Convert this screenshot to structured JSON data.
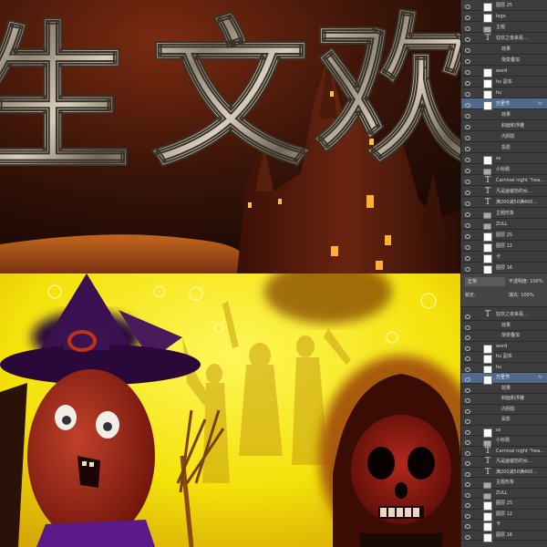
{
  "canvas_title_chars": [
    "生",
    "文",
    "欢"
  ],
  "top_layers": [
    {
      "name": "图层 25",
      "type": "image",
      "fx": ""
    },
    {
      "name": "logo",
      "type": "image",
      "fx": ""
    },
    {
      "name": "主题",
      "type": "folder",
      "fx": ""
    },
    {
      "name": "狂欢之夜来看…",
      "type": "text",
      "fx": ""
    },
    {
      "name": "效果",
      "type": "sub",
      "fx": ""
    },
    {
      "name": "渐变叠加",
      "type": "sub",
      "fx": ""
    },
    {
      "name": "word",
      "type": "image",
      "fx": ""
    },
    {
      "name": "hu 副本",
      "type": "image",
      "fx": ""
    },
    {
      "name": "hu",
      "type": "image",
      "fx": ""
    },
    {
      "name": "万圣节",
      "type": "image",
      "fx": "fx",
      "selected": true
    },
    {
      "name": "效果",
      "type": "sub",
      "fx": ""
    },
    {
      "name": "斜面和浮雕",
      "type": "sub",
      "fx": ""
    },
    {
      "name": "内阴影",
      "type": "sub",
      "fx": ""
    },
    {
      "name": "投影",
      "type": "sub",
      "fx": ""
    },
    {
      "name": "ss",
      "type": "image",
      "fx": ""
    },
    {
      "name": "小标题",
      "type": "folder",
      "fx": ""
    },
    {
      "name": "Carnival night \"hea…",
      "type": "text",
      "fx": ""
    },
    {
      "name": "凡是画装扮的女…",
      "type": "text",
      "fx": ""
    },
    {
      "name": "满200减50满400…",
      "type": "text",
      "fx": ""
    },
    {
      "name": "主题形象",
      "type": "folder",
      "fx": ""
    },
    {
      "name": "ZULL",
      "type": "folder",
      "fx": ""
    },
    {
      "name": "图层 25",
      "type": "image",
      "fx": ""
    },
    {
      "name": "图层 12",
      "type": "image",
      "fx": ""
    },
    {
      "name": "卡",
      "type": "image",
      "fx": ""
    },
    {
      "name": "图层 16",
      "type": "image",
      "fx": ""
    }
  ],
  "bottom_panel": {
    "tab": "图层",
    "blend_mode": "正常",
    "opacity_label": "不透明度:",
    "opacity_value": "100%",
    "lock_label": "锁定:",
    "fill_label": "填充:",
    "fill_value": "100%"
  },
  "bottom_layers": [
    {
      "name": "狂欢之夜来看…",
      "type": "text",
      "fx": ""
    },
    {
      "name": "效果",
      "type": "sub",
      "fx": ""
    },
    {
      "name": "渐变叠加",
      "type": "sub",
      "fx": ""
    },
    {
      "name": "word",
      "type": "image",
      "fx": ""
    },
    {
      "name": "hu 副本",
      "type": "image",
      "fx": ""
    },
    {
      "name": "hu",
      "type": "image",
      "fx": ""
    },
    {
      "name": "万圣节",
      "type": "image",
      "fx": "fx",
      "selected": true
    },
    {
      "name": "效果",
      "type": "sub",
      "fx": ""
    },
    {
      "name": "斜面和浮雕",
      "type": "sub",
      "fx": ""
    },
    {
      "name": "内阴影",
      "type": "sub",
      "fx": ""
    },
    {
      "name": "投影",
      "type": "sub",
      "fx": ""
    },
    {
      "name": "ss",
      "type": "image",
      "fx": ""
    },
    {
      "name": "小标题",
      "type": "folder",
      "fx": ""
    },
    {
      "name": "Carnival night \"hea…",
      "type": "text",
      "fx": ""
    },
    {
      "name": "凡是画装扮的女…",
      "type": "text",
      "fx": ""
    },
    {
      "name": "满200减50满400…",
      "type": "text",
      "fx": ""
    },
    {
      "name": "主题形象",
      "type": "folder",
      "fx": ""
    },
    {
      "name": "ZULL",
      "type": "folder",
      "fx": ""
    },
    {
      "name": "图层 25",
      "type": "image",
      "fx": ""
    },
    {
      "name": "图层 12",
      "type": "image",
      "fx": ""
    },
    {
      "name": "卡",
      "type": "image",
      "fx": ""
    },
    {
      "name": "图层 16",
      "type": "image",
      "fx": ""
    }
  ]
}
